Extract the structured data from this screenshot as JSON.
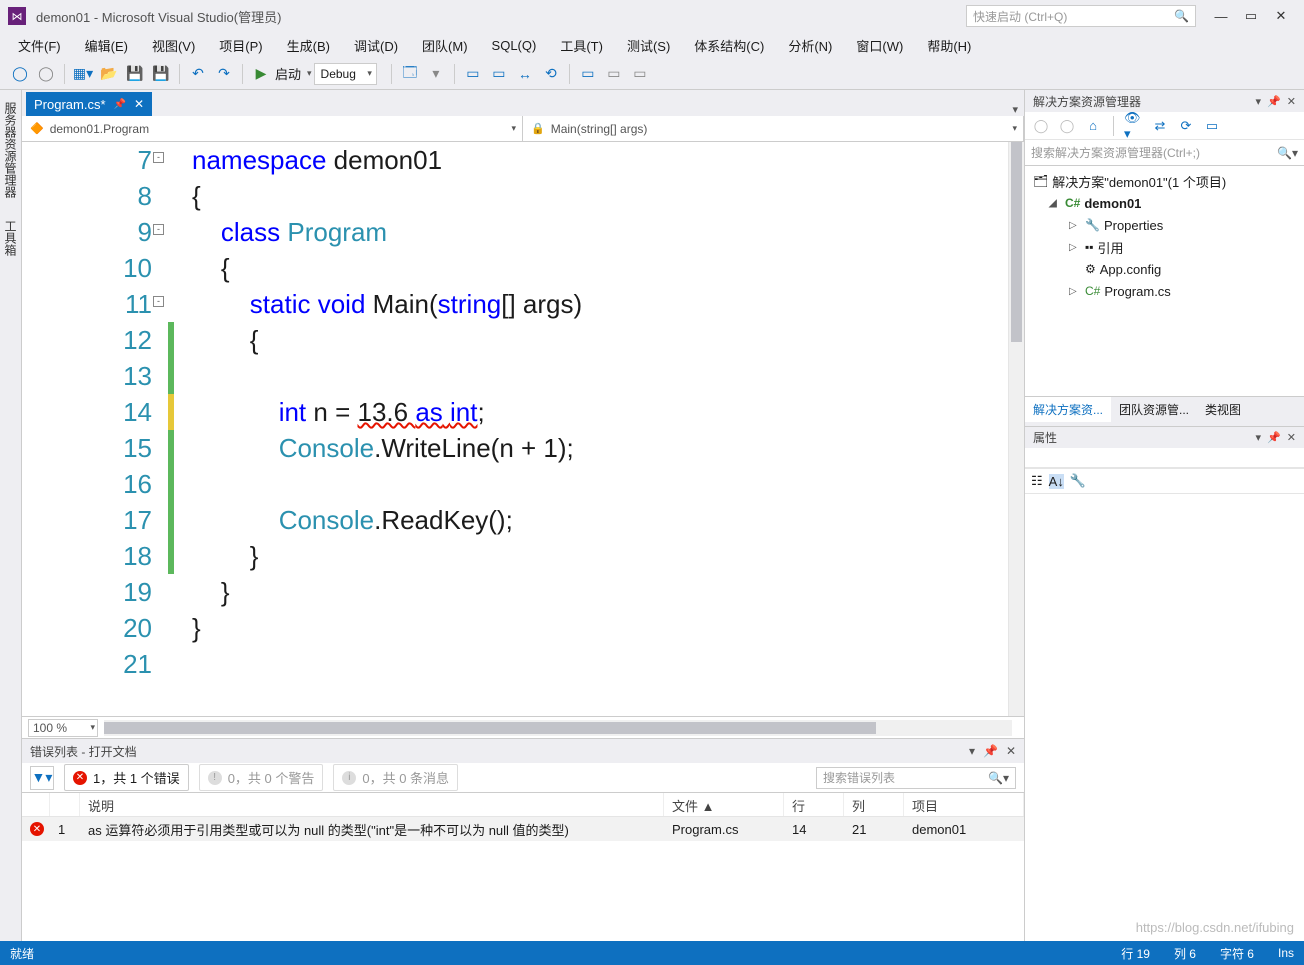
{
  "title": "demon01 - Microsoft Visual Studio(管理员)",
  "quick_launch_placeholder": "快速启动 (Ctrl+Q)",
  "menu": [
    "文件(F)",
    "编辑(E)",
    "视图(V)",
    "项目(P)",
    "生成(B)",
    "调试(D)",
    "团队(M)",
    "SQL(Q)",
    "工具(T)",
    "测试(S)",
    "体系结构(C)",
    "分析(N)",
    "窗口(W)",
    "帮助(H)"
  ],
  "toolbar": {
    "start_label": "启动",
    "config": "Debug"
  },
  "left_rail": [
    "服务器资源管理器",
    "工具箱"
  ],
  "tab": {
    "name": "Program.cs*"
  },
  "nav": {
    "scope": "demon01.Program",
    "member": "Main(string[] args)"
  },
  "code": {
    "lines": [
      {
        "n": 7,
        "fold": "-",
        "html": "<span class='kw'>namespace</span> demon01"
      },
      {
        "n": 8,
        "html": "{"
      },
      {
        "n": 9,
        "fold": "-",
        "html": "    <span class='kw'>class</span> <span class='typ'>Program</span>"
      },
      {
        "n": 10,
        "html": "    {"
      },
      {
        "n": 11,
        "fold": "-",
        "html": "        <span class='kw'>static</span> <span class='kw'>void</span> Main(<span class='kw'>string</span>[] args)"
      },
      {
        "n": 12,
        "chg": "green",
        "html": "        {"
      },
      {
        "n": 13,
        "chg": "green",
        "html": ""
      },
      {
        "n": 14,
        "chg": "yellow",
        "html": "            <span class='kw'>int</span> n = <span class='err-underline'>13.6 <span class='kw'>as</span> <span class='kw'>int</span></span>;"
      },
      {
        "n": 15,
        "chg": "green",
        "html": "            <span class='typ'>Console</span>.WriteLine(n + 1);"
      },
      {
        "n": 16,
        "chg": "green",
        "html": ""
      },
      {
        "n": 17,
        "chg": "green",
        "html": "            <span class='typ'>Console</span>.ReadKey();"
      },
      {
        "n": 18,
        "chg": "green",
        "html": "        }"
      },
      {
        "n": 19,
        "html": "    }"
      },
      {
        "n": 20,
        "html": "}"
      },
      {
        "n": 21,
        "html": ""
      }
    ]
  },
  "zoom": "100 %",
  "error_panel": {
    "title": "错误列表 - 打开文档",
    "chips": {
      "errors": "1，共 1 个错误",
      "warnings": "0，共 0 个警告",
      "messages": "0，共 0 条消息"
    },
    "search_placeholder": "搜索错误列表",
    "cols": {
      "desc": "说明",
      "file": "文件 ▲",
      "line": "行",
      "col": "列",
      "proj": "项目"
    },
    "row": {
      "num": "1",
      "desc": "as 运算符必须用于引用类型或可以为 null 的类型(\"int\"是一种不可以为 null 值的类型)",
      "file": "Program.cs",
      "line": "14",
      "col": "21",
      "proj": "demon01"
    }
  },
  "solution": {
    "title": "解决方案资源管理器",
    "search_placeholder": "搜索解决方案资源管理器(Ctrl+;)",
    "root": "解决方案\"demon01\"(1 个项目)",
    "items": [
      "demon01",
      "Properties",
      "引用",
      "App.config",
      "Program.cs"
    ],
    "bottom_tabs": [
      "解决方案资...",
      "团队资源管...",
      "类视图"
    ]
  },
  "properties": {
    "title": "属性"
  },
  "status": {
    "ready": "就绪",
    "line": "行 19",
    "col": "列 6",
    "char": "字符 6",
    "ins": "Ins"
  },
  "watermark": "https://blog.csdn.net/ifubing"
}
